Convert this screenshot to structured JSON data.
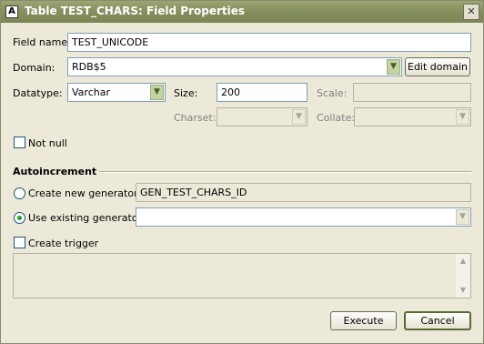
{
  "window": {
    "title": "Table TEST_CHARS: Field Properties",
    "app_icon": "A",
    "close_glyph": "✕"
  },
  "field_name": {
    "label": "Field name:",
    "value": "TEST_UNICODE"
  },
  "domain": {
    "label": "Domain:",
    "value": "RDB$5",
    "edit_button": "Edit domain"
  },
  "datatype": {
    "label": "Datatype:",
    "value": "Varchar"
  },
  "size": {
    "label": "Size:",
    "value": "200"
  },
  "scale": {
    "label": "Scale:",
    "value": ""
  },
  "charset": {
    "label": "Charset:",
    "value": ""
  },
  "collate": {
    "label": "Collate:",
    "value": ""
  },
  "not_null": {
    "label": "Not null",
    "checked": false
  },
  "autoincrement": {
    "heading": "Autoincrement",
    "create_new": {
      "label": "Create new generator:",
      "value": "GEN_TEST_CHARS_ID",
      "selected": false
    },
    "use_existing": {
      "label": "Use existing generator:",
      "value": "",
      "selected": true
    },
    "create_trigger": {
      "label": "Create trigger",
      "checked": false
    }
  },
  "buttons": {
    "execute": "Execute",
    "cancel": "Cancel"
  },
  "icons": {
    "dropdown": "chevron-down-icon",
    "scroll_up": "arrow-up-icon",
    "scroll_down": "arrow-down-icon"
  },
  "colors": {
    "titlebar": "#86915f",
    "dialog_bg": "#ece9d8",
    "radio_dot": "#21a121"
  }
}
